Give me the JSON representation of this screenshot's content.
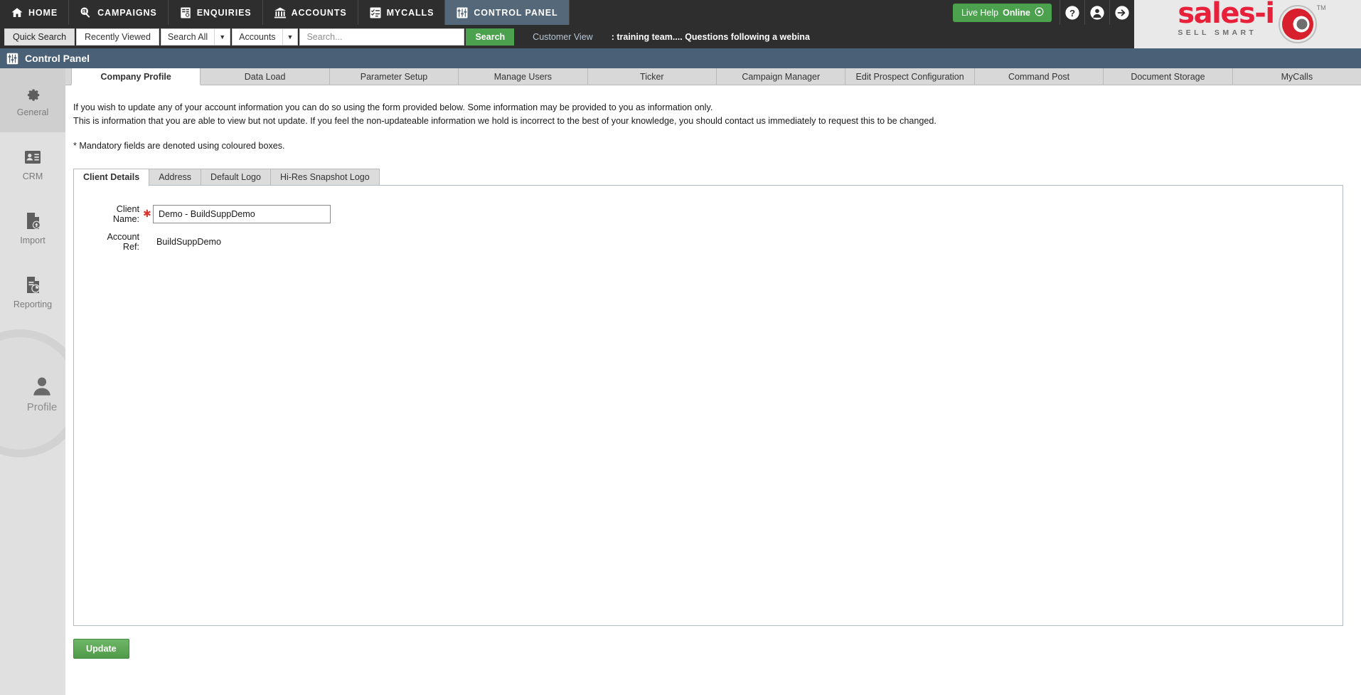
{
  "topnav": {
    "items": [
      {
        "label": "HOME",
        "icon": "home-icon",
        "active": false
      },
      {
        "label": "CAMPAIGNS",
        "icon": "megaphone-icon",
        "active": false
      },
      {
        "label": "ENQUIRIES",
        "icon": "document-search-icon",
        "active": false
      },
      {
        "label": "ACCOUNTS",
        "icon": "bank-icon",
        "active": false
      },
      {
        "label": "MYCALLS",
        "icon": "checklist-icon",
        "active": false
      },
      {
        "label": "CONTROL PANEL",
        "icon": "sliders-icon",
        "active": true
      }
    ],
    "live_help": {
      "prefix": "Live Help",
      "status": "Online",
      "icon": "info-circle-icon"
    },
    "help_icon": "question-mark-icon",
    "account_icon": "user-avatar-icon",
    "logout_icon": "arrow-right-circle-icon"
  },
  "logo": {
    "word": "sales-i",
    "tagline": "SELL SMART",
    "trademark": "TM",
    "accent_color": "#e8203a"
  },
  "searchbar": {
    "quick_search_label": "Quick Search",
    "recently_viewed_label": "Recently Viewed",
    "scope_select": "Search All",
    "type_select": "Accounts",
    "input_value": "",
    "input_placeholder": "Search...",
    "search_button": "Search",
    "customer_view_link": "Customer View",
    "ticker_text": ": training team.... Questions following a webina"
  },
  "pagetitle": {
    "title": "Control Panel",
    "icon": "sliders-icon"
  },
  "sidebar": {
    "items": [
      {
        "label": "General",
        "icon": "gear-icon",
        "active": true
      },
      {
        "label": "CRM",
        "icon": "contact-card-icon",
        "active": false
      },
      {
        "label": "Import",
        "icon": "document-upload-icon",
        "active": false
      },
      {
        "label": "Reporting",
        "icon": "document-chart-icon",
        "active": false
      }
    ],
    "profile": {
      "label": "Profile",
      "icon": "person-icon"
    }
  },
  "tabs": [
    {
      "label": "Company Profile",
      "active": true
    },
    {
      "label": "Data Load",
      "active": false
    },
    {
      "label": "Parameter Setup",
      "active": false
    },
    {
      "label": "Manage Users",
      "active": false
    },
    {
      "label": "Ticker",
      "active": false
    },
    {
      "label": "Campaign Manager",
      "active": false
    },
    {
      "label": "Edit Prospect Configuration",
      "active": false
    },
    {
      "label": "Command Post",
      "active": false
    },
    {
      "label": "Document Storage",
      "active": false
    },
    {
      "label": "MyCalls",
      "active": false
    }
  ],
  "intro": {
    "line1": "If you wish to update any of your account information you can do so using the form provided below. Some information may be provided to you as information only.",
    "line2": "This is information that you are able to view but not update. If you feel the non-updateable information we hold is incorrect to the best of your knowledge, you should contact us immediately to request this to be changed.",
    "mandatory_note": "* Mandatory fields are denoted using coloured boxes."
  },
  "inner_tabs": [
    {
      "label": "Client Details",
      "active": true
    },
    {
      "label": "Address",
      "active": false
    },
    {
      "label": "Default Logo",
      "active": false
    },
    {
      "label": "Hi-Res Snapshot Logo",
      "active": false
    }
  ],
  "form": {
    "client_name": {
      "label": "Client Name:",
      "required_marker": "✱",
      "value": "Demo - BuildSuppDemo"
    },
    "account_ref": {
      "label": "Account Ref:",
      "value": "BuildSuppDemo"
    }
  },
  "update_button": "Update"
}
